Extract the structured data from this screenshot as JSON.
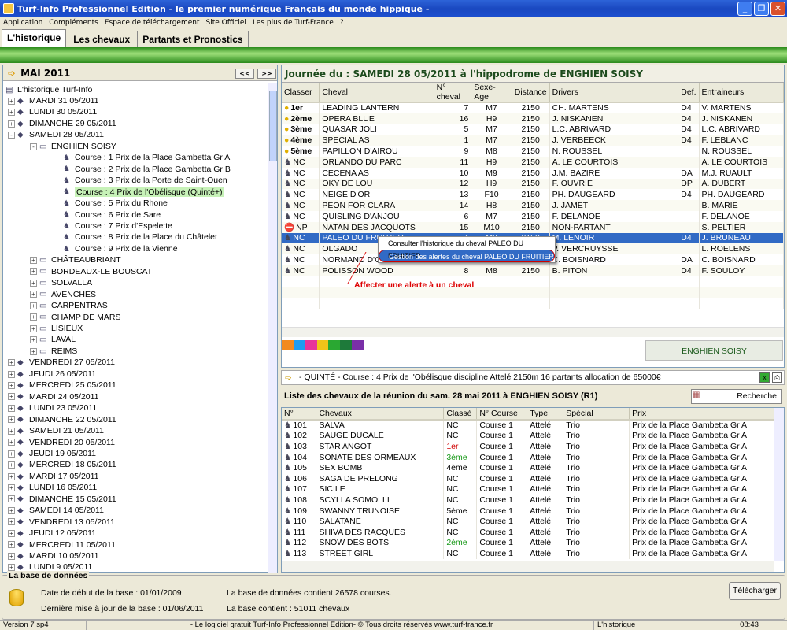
{
  "window": {
    "title": "Turf-Info Professionnel Edition - le premier numérique Français du monde hippique -"
  },
  "menu": [
    "Application",
    "Compléments",
    "Espace de téléchargement",
    "Site Officiel",
    "Les plus de Turf-France",
    "?"
  ],
  "tabs": [
    "L'historique",
    "Les chevaux",
    "Partants et Pronostics"
  ],
  "left": {
    "month": "MAI 2011",
    "prev": "<<",
    "next": ">>",
    "root": "L'historique Turf-Info",
    "tree": [
      {
        "label": "MARDI 31 05/2011",
        "level": 1,
        "icon": "day",
        "ex": "+"
      },
      {
        "label": "LUNDI 30 05/2011",
        "level": 1,
        "icon": "day",
        "ex": "+"
      },
      {
        "label": "DIMANCHE 29 05/2011",
        "level": 1,
        "icon": "day",
        "ex": "+"
      },
      {
        "label": "SAMEDI 28 05/2011",
        "level": 1,
        "icon": "day",
        "ex": "-"
      },
      {
        "label": "ENGHIEN SOISY",
        "level": 2,
        "icon": "doc",
        "ex": "-"
      },
      {
        "label": "Course : 1 Prix de la Place Gambetta Gr A",
        "level": 3,
        "icon": "horse"
      },
      {
        "label": "Course : 2 Prix de la Place Gambetta Gr B",
        "level": 3,
        "icon": "horse"
      },
      {
        "label": "Course : 3 Prix de la Porte de Saint-Ouen",
        "level": 3,
        "icon": "horse"
      },
      {
        "label": "Course : 4 Prix de l'Obélisque (Quinté+)",
        "level": 3,
        "icon": "horse",
        "sel": true
      },
      {
        "label": "Course : 5 Prix du Rhone",
        "level": 3,
        "icon": "horse"
      },
      {
        "label": "Course : 6 Prix de Sare",
        "level": 3,
        "icon": "horse"
      },
      {
        "label": "Course : 7 Prix d'Espelette",
        "level": 3,
        "icon": "horse"
      },
      {
        "label": "Course : 8 Prix de la Place du Châtelet",
        "level": 3,
        "icon": "horse"
      },
      {
        "label": "Course : 9 Prix de la Vienne",
        "level": 3,
        "icon": "horse"
      },
      {
        "label": "CHÂTEAUBRIANT",
        "level": 2,
        "icon": "doc",
        "ex": "+"
      },
      {
        "label": "BORDEAUX-LE BOUSCAT",
        "level": 2,
        "icon": "doc",
        "ex": "+"
      },
      {
        "label": "SOLVALLA",
        "level": 2,
        "icon": "doc",
        "ex": "+"
      },
      {
        "label": "AVENCHES",
        "level": 2,
        "icon": "doc",
        "ex": "+"
      },
      {
        "label": "CARPENTRAS",
        "level": 2,
        "icon": "doc",
        "ex": "+"
      },
      {
        "label": "CHAMP DE MARS",
        "level": 2,
        "icon": "doc",
        "ex": "+"
      },
      {
        "label": "LISIEUX",
        "level": 2,
        "icon": "doc",
        "ex": "+"
      },
      {
        "label": "LAVAL",
        "level": 2,
        "icon": "doc",
        "ex": "+"
      },
      {
        "label": "REIMS",
        "level": 2,
        "icon": "doc",
        "ex": "+"
      },
      {
        "label": "VENDREDI 27 05/2011",
        "level": 1,
        "icon": "day",
        "ex": "+"
      },
      {
        "label": "JEUDI 26 05/2011",
        "level": 1,
        "icon": "day",
        "ex": "+"
      },
      {
        "label": "MERCREDI 25 05/2011",
        "level": 1,
        "icon": "day",
        "ex": "+"
      },
      {
        "label": "MARDI 24 05/2011",
        "level": 1,
        "icon": "day",
        "ex": "+"
      },
      {
        "label": "LUNDI 23 05/2011",
        "level": 1,
        "icon": "day",
        "ex": "+"
      },
      {
        "label": "DIMANCHE 22 05/2011",
        "level": 1,
        "icon": "day",
        "ex": "+"
      },
      {
        "label": "SAMEDI 21 05/2011",
        "level": 1,
        "icon": "day",
        "ex": "+"
      },
      {
        "label": "VENDREDI 20 05/2011",
        "level": 1,
        "icon": "day",
        "ex": "+"
      },
      {
        "label": "JEUDI 19 05/2011",
        "level": 1,
        "icon": "day",
        "ex": "+"
      },
      {
        "label": "MERCREDI 18 05/2011",
        "level": 1,
        "icon": "day",
        "ex": "+"
      },
      {
        "label": "MARDI 17 05/2011",
        "level": 1,
        "icon": "day",
        "ex": "+"
      },
      {
        "label": "LUNDI 16 05/2011",
        "level": 1,
        "icon": "day",
        "ex": "+"
      },
      {
        "label": "DIMANCHE 15 05/2011",
        "level": 1,
        "icon": "day",
        "ex": "+"
      },
      {
        "label": "SAMEDI 14 05/2011",
        "level": 1,
        "icon": "day",
        "ex": "+"
      },
      {
        "label": "VENDREDI 13 05/2011",
        "level": 1,
        "icon": "day",
        "ex": "+"
      },
      {
        "label": "JEUDI 12 05/2011",
        "level": 1,
        "icon": "day",
        "ex": "+"
      },
      {
        "label": "MERCREDI 11 05/2011",
        "level": 1,
        "icon": "day",
        "ex": "+"
      },
      {
        "label": "MARDI 10 05/2011",
        "level": 1,
        "icon": "day",
        "ex": "+"
      },
      {
        "label": "LUNDI 9 05/2011",
        "level": 1,
        "icon": "day",
        "ex": "+"
      }
    ]
  },
  "race": {
    "header": "Journée du : SAMEDI 28 05/2011 à l'hippodrome de ENGHIEN SOISY",
    "columns": [
      "Classer",
      "Cheval",
      "N° cheval",
      "Sexe-Age",
      "Distance",
      "Drivers",
      "Def.",
      "Entraineurs"
    ],
    "rows": [
      [
        "1er",
        "LEADING LANTERN",
        "7",
        "M7",
        "2150",
        "CH. MARTENS",
        "D4",
        "V. MARTENS"
      ],
      [
        "2ème",
        "OPERA BLUE",
        "16",
        "H9",
        "2150",
        "J. NISKANEN",
        "D4",
        "J. NISKANEN"
      ],
      [
        "3ème",
        "QUASAR JOLI",
        "5",
        "M7",
        "2150",
        "L.C. ABRIVARD",
        "D4",
        "L.C. ABRIVARD"
      ],
      [
        "4ème",
        "SPECIAL AS",
        "1",
        "M7",
        "2150",
        "J. VERBEECK",
        "D4",
        "F. LEBLANC"
      ],
      [
        "5ème",
        "PAPILLON D'AIROU",
        "9",
        "M8",
        "2150",
        "N. ROUSSEL",
        "",
        "N. ROUSSEL"
      ],
      [
        "NC",
        "ORLANDO DU PARC",
        "11",
        "H9",
        "2150",
        "A. LE COURTOIS",
        "",
        "A. LE COURTOIS"
      ],
      [
        "NC",
        "CECENA AS",
        "10",
        "M9",
        "2150",
        "J.M. BAZIRE",
        "DA",
        "M.J. RUAULT"
      ],
      [
        "NC",
        "OKY DE LOU",
        "12",
        "H9",
        "2150",
        "F. OUVRIE",
        "DP",
        "A. DUBERT"
      ],
      [
        "NC",
        "NEIGE D'OR",
        "13",
        "F10",
        "2150",
        "PH. DAUGEARD",
        "D4",
        "PH. DAUGEARD"
      ],
      [
        "NC",
        "PEON FOR CLARA",
        "14",
        "H8",
        "2150",
        "J. JAMET",
        "",
        "B. MARIE"
      ],
      [
        "NC",
        "QUISLING D'ANJOU",
        "6",
        "M7",
        "2150",
        "F. DELANOE",
        "",
        "F. DELANOE"
      ],
      [
        "NP",
        "NATAN DES JACQUOTS",
        "15",
        "M10",
        "2150",
        "NON-PARTANT",
        "",
        "S. PELTIER"
      ],
      [
        "NC",
        "PALEO DU FRUITIER",
        "4",
        "M8",
        "2150",
        "M. LENOIR",
        "D4",
        "J. BRUNEAU"
      ],
      [
        "NC",
        "OLGADO",
        "",
        "",
        "",
        "P. VERCRUYSSE",
        "",
        "L. ROELENS"
      ],
      [
        "NC",
        "NORMAND D'C",
        "",
        "",
        "",
        "C. BOISNARD",
        "DA",
        "C. BOISNARD"
      ],
      [
        "NC",
        "POLISSON WOOD",
        "8",
        "M8",
        "2150",
        "B. PITON",
        "D4",
        "F. SOULOY"
      ]
    ],
    "context_menu": [
      "Consulter l'historique du cheval PALEO DU FRUITIER",
      "Gestion des alertes du cheval PALEO DU FRUITIER"
    ],
    "annotation": "Affecter une alerte à un cheval",
    "hippodrome_btn": "ENGHIEN SOISY",
    "colors": [
      "#f28a1e",
      "#1e9cf0",
      "#e8349a",
      "#f0c419",
      "#2aa832",
      "#1e7a3a",
      "#7a2fa8"
    ]
  },
  "quinte": "- QUINTÉ - Course : 4 Prix de l'Obélisque discipline Attelé 2150m 16 partants allocation de 65000€",
  "list": {
    "title": "Liste des chevaux de la réunion du sam. 28 mai 2011 à ENGHIEN SOISY (R1)",
    "search": "Recherche",
    "columns": [
      "N°",
      "Chevaux",
      "Classé",
      "N° Course",
      "Type",
      "Spécial",
      "Prix"
    ],
    "rows": [
      [
        "101",
        "SALVA",
        "NC",
        "Course 1",
        "Attelé",
        "Trio",
        "Prix de la Place Gambetta Gr A"
      ],
      [
        "102",
        "SAUGE DUCALE",
        "NC",
        "Course 1",
        "Attelé",
        "Trio",
        "Prix de la Place Gambetta Gr A"
      ],
      [
        "103",
        "STAR ANGOT",
        "1er",
        "Course 1",
        "Attelé",
        "Trio",
        "Prix de la Place Gambetta Gr A"
      ],
      [
        "104",
        "SONATE DES ORMEAUX",
        "3ème",
        "Course 1",
        "Attelé",
        "Trio",
        "Prix de la Place Gambetta Gr A"
      ],
      [
        "105",
        "SEX BOMB",
        "4ème",
        "Course 1",
        "Attelé",
        "Trio",
        "Prix de la Place Gambetta Gr A"
      ],
      [
        "106",
        "SAGA DE PRELONG",
        "NC",
        "Course 1",
        "Attelé",
        "Trio",
        "Prix de la Place Gambetta Gr A"
      ],
      [
        "107",
        "SICILE",
        "NC",
        "Course 1",
        "Attelé",
        "Trio",
        "Prix de la Place Gambetta Gr A"
      ],
      [
        "108",
        "SCYLLA SOMOLLI",
        "NC",
        "Course 1",
        "Attelé",
        "Trio",
        "Prix de la Place Gambetta Gr A"
      ],
      [
        "109",
        "SWANNY TRUNOISE",
        "5ème",
        "Course 1",
        "Attelé",
        "Trio",
        "Prix de la Place Gambetta Gr A"
      ],
      [
        "110",
        "SALATANE",
        "NC",
        "Course 1",
        "Attelé",
        "Trio",
        "Prix de la Place Gambetta Gr A"
      ],
      [
        "111",
        "SHIVA DES RACQUES",
        "NC",
        "Course 1",
        "Attelé",
        "Trio",
        "Prix de la Place Gambetta Gr A"
      ],
      [
        "112",
        "SNOW DES BOTS",
        "2ème",
        "Course 1",
        "Attelé",
        "Trio",
        "Prix de la Place Gambetta Gr A"
      ],
      [
        "113",
        "STREET GIRL",
        "NC",
        "Course 1",
        "Attelé",
        "Trio",
        "Prix de la Place Gambetta Gr A"
      ]
    ],
    "classe_colors": {
      "1er": "#d00000",
      "2ème": "#1a9a1a",
      "3ème": "#1a9a1a"
    }
  },
  "base": {
    "title": "La base de données",
    "start": "Date de début de la base :  01/01/2009",
    "update": "Dernière mise à jour de la base : 01/06/2011",
    "courses": "La base de données contient 26578 courses.",
    "chevaux": "La base contient : 51011 chevaux",
    "download": "Télécharger"
  },
  "status": {
    "version": "Version 7 sp4",
    "message": "- Le logiciel gratuit Turf-Info Professionnel Edition- © Tous droits réservés www.turf-france.fr",
    "section": "L'historique",
    "time": "08:43"
  }
}
